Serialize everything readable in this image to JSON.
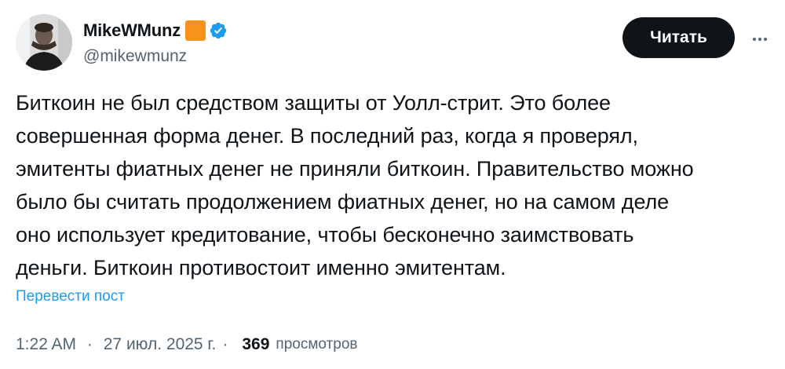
{
  "author": {
    "display_name": "MikeWMunz",
    "handle": "@mikewmunz",
    "badge_color": "#f7931a",
    "verified_icon": "verified-badge-icon",
    "verified_color": "#1d9bf0"
  },
  "actions": {
    "follow_label": "Читать",
    "more_icon": "more-horizontal-icon"
  },
  "tweet": {
    "lines": [
      "Биткоин не был средством защиты от Уолл-стрит. Это более",
      "совершенная форма денег. В последний раз, когда я проверял,",
      "эмитенты фиатных денег не приняли биткоин. Правительство можно",
      "было бы считать продолжением фиатных денег, но на самом деле",
      "оно использует кредитование, чтобы бесконечно заимствовать",
      "деньги. Биткоин противостоит именно эмитентам."
    ],
    "translate_label": "Перевести пост"
  },
  "meta": {
    "time": "1:22 AM",
    "date": "27 июл. 2025 г.",
    "separator": "·",
    "views_count": "369",
    "views_label": "просмотров"
  },
  "colors": {
    "text": "#0f1419",
    "secondary": "#536471",
    "link": "#1d9bf0",
    "button_bg": "#0f1419"
  }
}
